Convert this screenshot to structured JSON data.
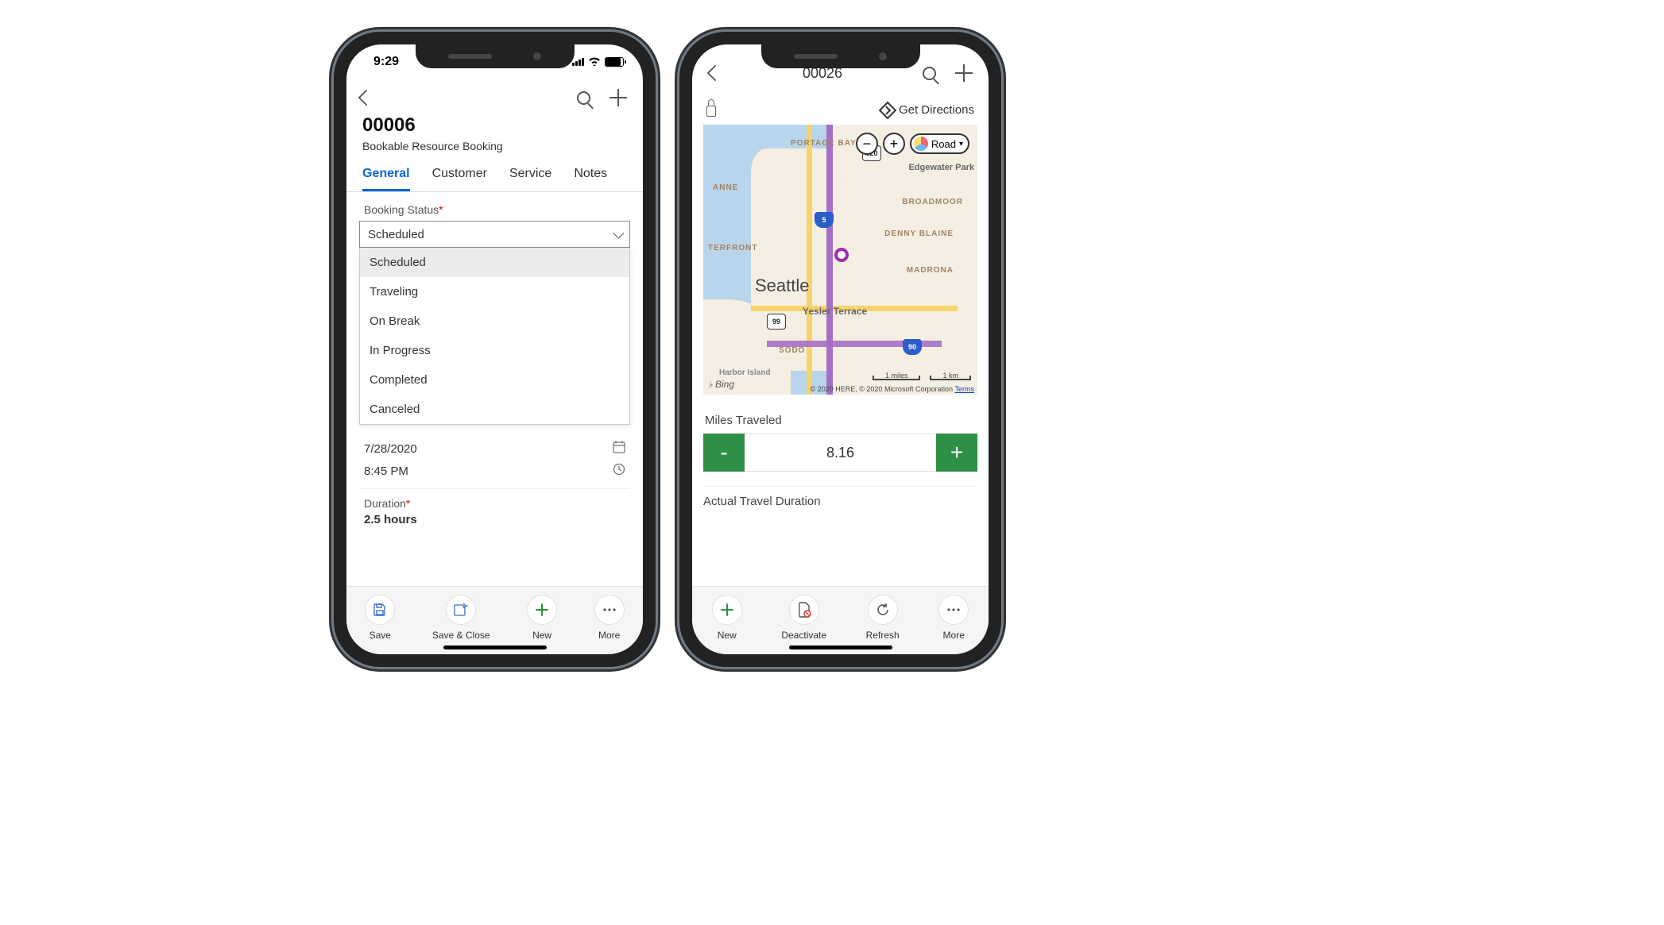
{
  "phone1": {
    "status_time": "9:29",
    "header": {
      "title": "00006",
      "subtitle": "Bookable Resource Booking"
    },
    "tabs": [
      "General",
      "Customer",
      "Service",
      "Notes"
    ],
    "active_tab": 0,
    "form": {
      "booking_status": {
        "label": "Booking Status",
        "value": "Scheduled",
        "options": [
          "Scheduled",
          "Traveling",
          "On Break",
          "In Progress",
          "Completed",
          "Canceled"
        ]
      },
      "date": "7/28/2020",
      "time": "8:45 PM",
      "duration": {
        "label": "Duration",
        "value": "2.5 hours"
      }
    },
    "commands": {
      "save": "Save",
      "save_close": "Save & Close",
      "new": "New",
      "more": "More"
    }
  },
  "phone2": {
    "header": {
      "title": "00026"
    },
    "get_directions": "Get Directions",
    "map": {
      "type_label": "Road",
      "neighborhoods": {
        "portage_bay": "PORTAGE BAY",
        "edgewater": "Edgewater Park",
        "anne": "ANNE",
        "broadmoor": "BROADMOOR",
        "denny_blaine": "DENNY BLAINE",
        "terfront": "TERFRONT",
        "madrona": "MADRONA",
        "yesler": "Yesler Terrace",
        "sodo": "SODO",
        "harbor": "Harbor Island"
      },
      "city": "Seattle",
      "shields": {
        "i5": "5",
        "sr520": "520",
        "sr99": "99",
        "i90": "90"
      },
      "bing": "Bing",
      "scale": {
        "miles": "1 miles",
        "km": "1 km"
      },
      "attribution": "© 2020 HERE, © 2020 Microsoft Corporation",
      "terms": "Terms"
    },
    "miles": {
      "label": "Miles Traveled",
      "value": "8.16"
    },
    "actual_travel": "Actual Travel Duration",
    "commands": {
      "new": "New",
      "deactivate": "Deactivate",
      "refresh": "Refresh",
      "more": "More"
    }
  }
}
